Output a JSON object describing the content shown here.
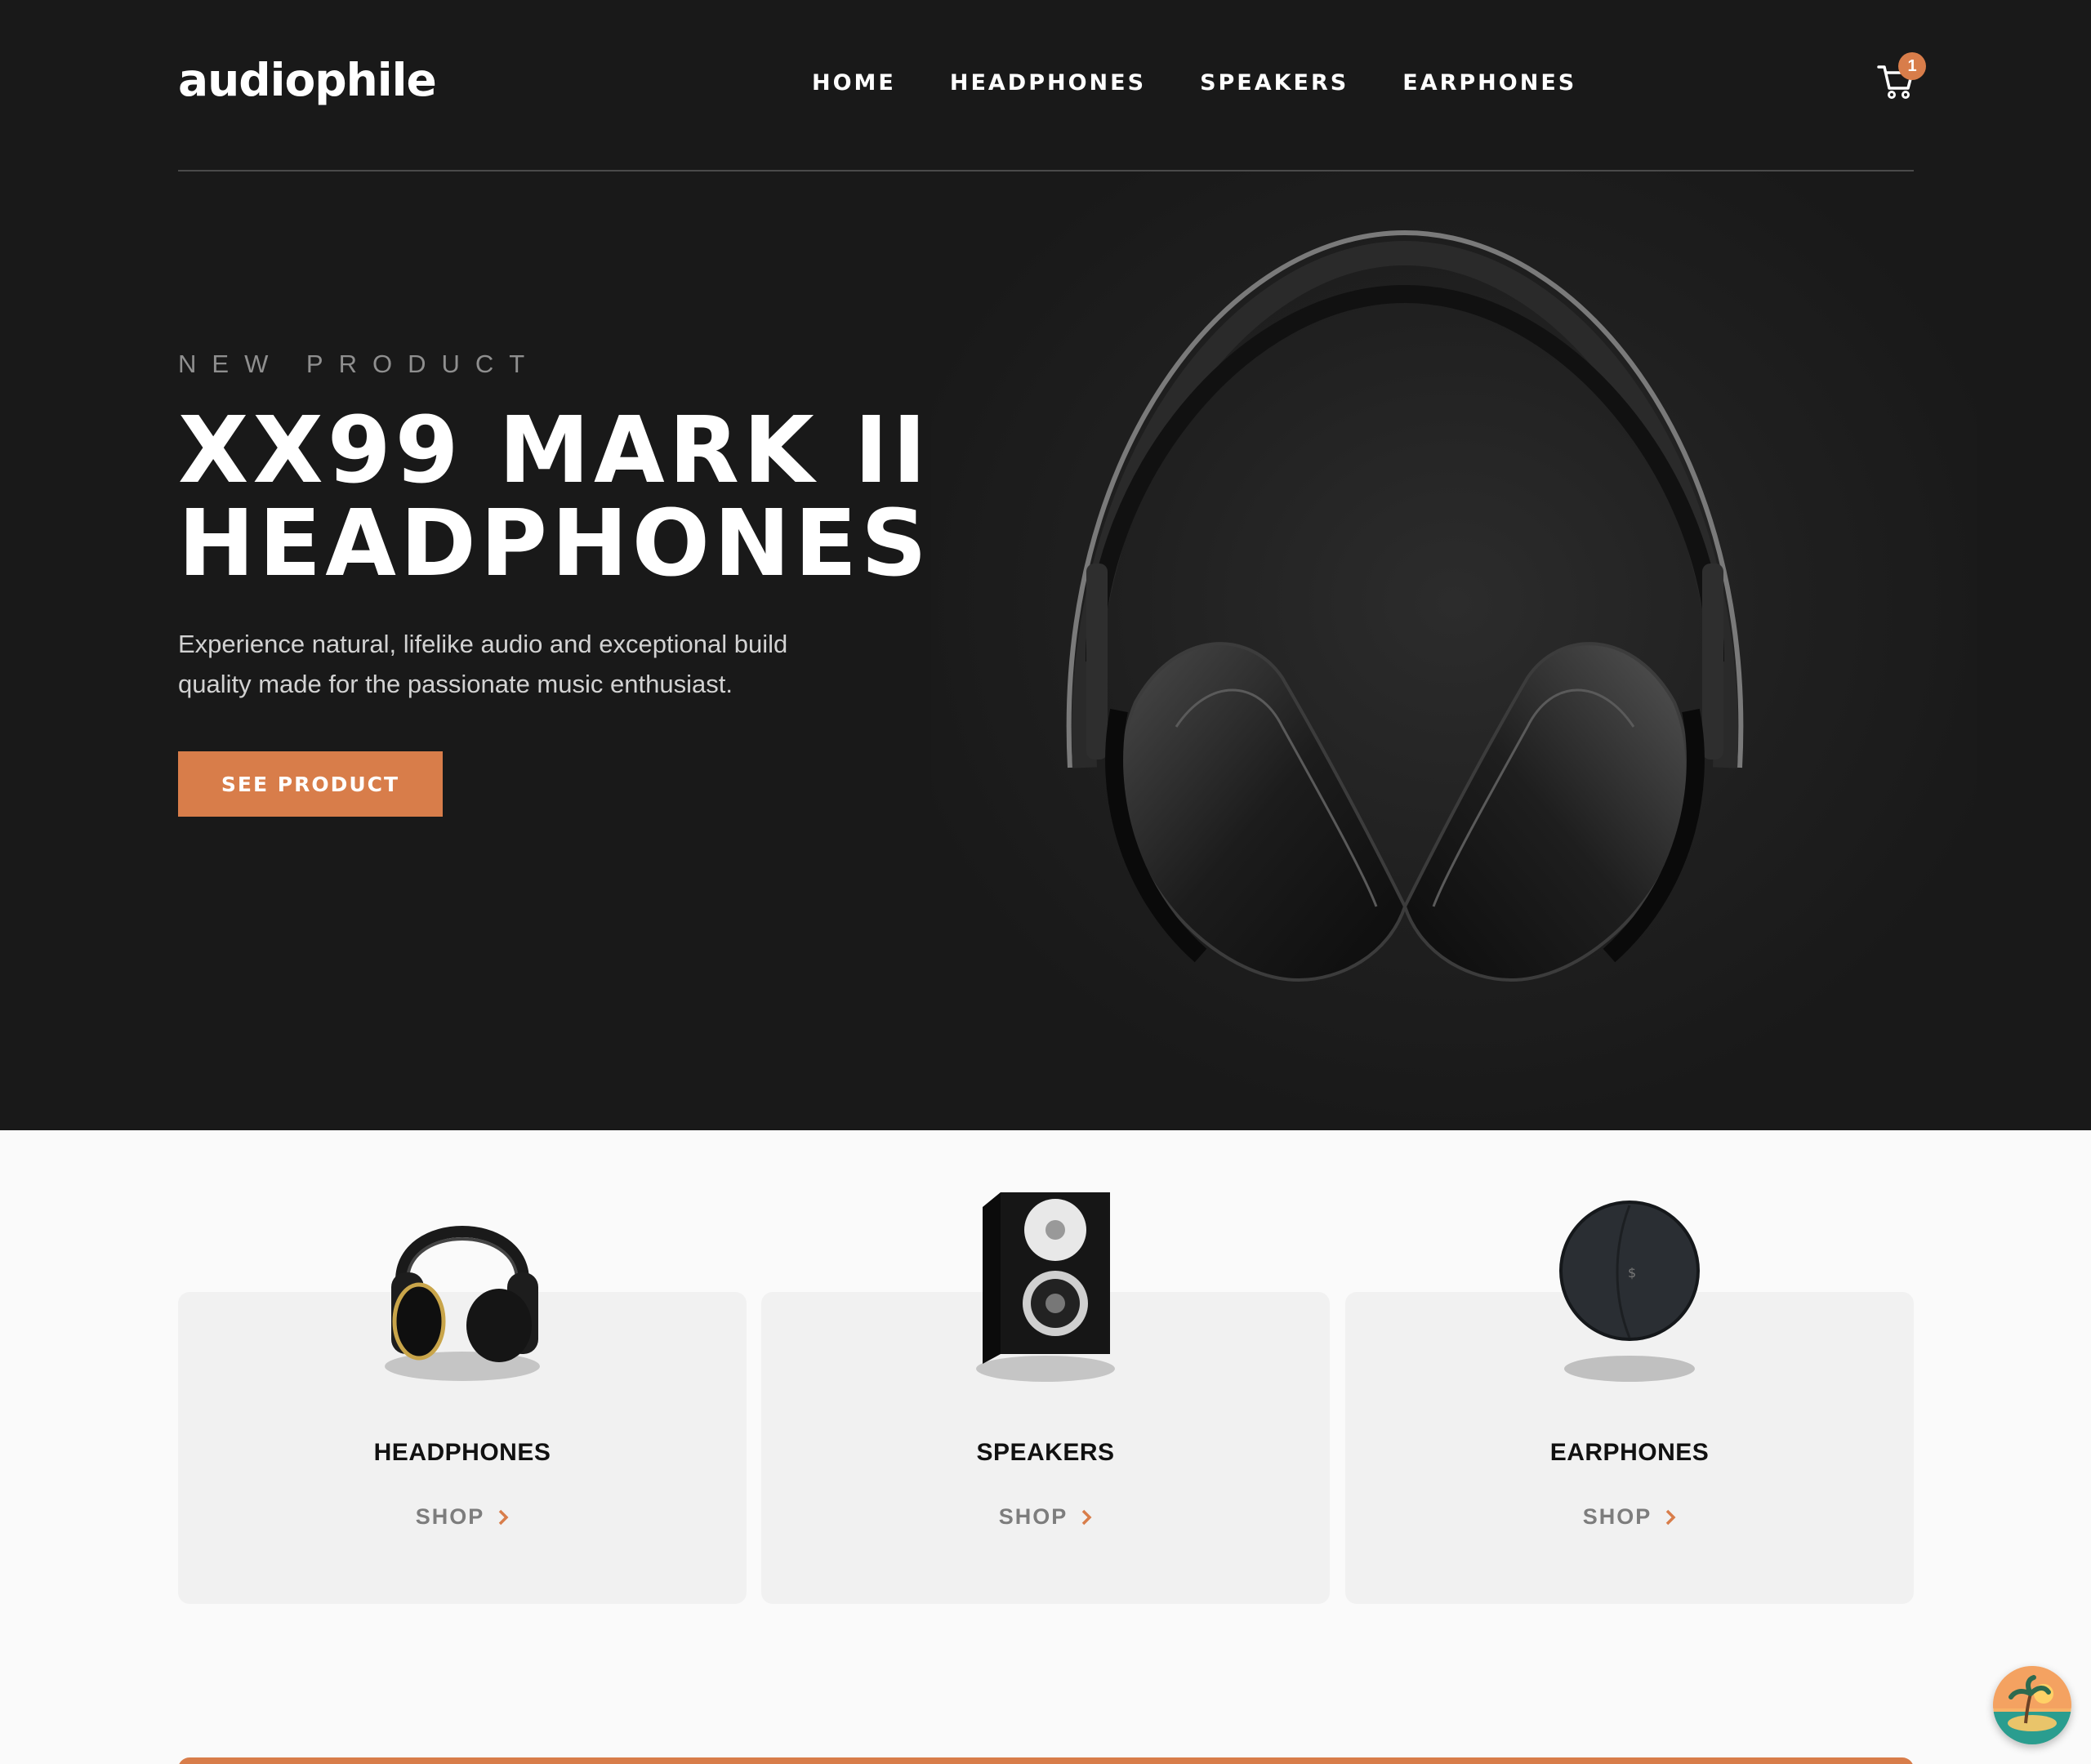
{
  "header": {
    "logo": "audiophile",
    "nav": [
      "HOME",
      "HEADPHONES",
      "SPEAKERS",
      "EARPHONES"
    ],
    "cart_count": "1",
    "cart_icon": "cart-icon"
  },
  "hero": {
    "overline": "NEW PRODUCT",
    "title_line1": "XX99 MARK II",
    "title_line2": "HEADPHONES",
    "description": "Experience natural, lifelike audio and exceptional build quality made for the passionate music enthusiast.",
    "cta": "SEE PRODUCT"
  },
  "categories": [
    {
      "name": "HEADPHONES",
      "shop": "SHOP"
    },
    {
      "name": "SPEAKERS",
      "shop": "SHOP"
    },
    {
      "name": "EARPHONES",
      "shop": "SHOP"
    }
  ],
  "colors": {
    "accent": "#d87d4a",
    "dark": "#191919",
    "light_bg": "#fafafa",
    "card_bg": "#f1f1f1"
  }
}
